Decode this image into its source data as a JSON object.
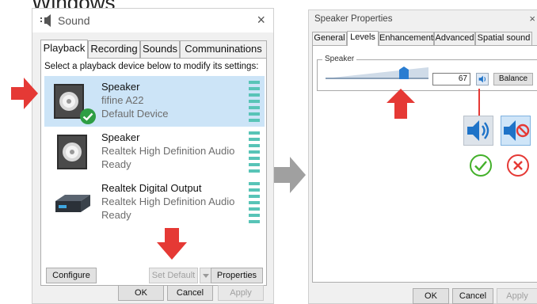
{
  "caption": "Windows",
  "sound_window": {
    "title": "Sound",
    "close_glyph": "×",
    "tabs": [
      {
        "label": "Playback",
        "active": true
      },
      {
        "label": "Recording",
        "active": false
      },
      {
        "label": "Sounds",
        "active": false
      },
      {
        "label": "Communinations",
        "active": false
      }
    ],
    "hint": "Select a playback device below to modify its settings:",
    "devices": [
      {
        "name": "Speaker",
        "sub": "fifine A22",
        "state": "Default Device",
        "selected": true,
        "icon": "speaker-box-icon",
        "badge": "green-check-icon"
      },
      {
        "name": "Speaker",
        "sub": "Realtek High Definition Audio",
        "state": "Ready",
        "selected": false,
        "icon": "speaker-box-icon"
      },
      {
        "name": "Realtek Digital Output",
        "sub": "Realtek High Definition Audio",
        "state": "Ready",
        "selected": false,
        "icon": "digital-output-box-icon"
      }
    ],
    "buttons": {
      "configure": "Configure",
      "set_default": "Set Default",
      "properties": "Properties",
      "ok": "OK",
      "cancel": "Cancel",
      "apply": "Apply"
    }
  },
  "props_window": {
    "title": "Speaker Properties",
    "close_glyph": "×",
    "tabs": [
      {
        "label": "General",
        "active": false
      },
      {
        "label": "Levels",
        "active": true
      },
      {
        "label": "Enhancements",
        "active": false
      },
      {
        "label": "Advanced",
        "active": false
      },
      {
        "label": "Spatial sound",
        "active": false
      }
    ],
    "group_label": "Speaker",
    "volume": "67",
    "balance_label": "Balance",
    "buttons": {
      "ok": "OK",
      "cancel": "Cancel",
      "apply": "Apply"
    }
  },
  "annotations": {
    "unmuted_icon": "speaker-unmuted-icon",
    "muted_icon": "speaker-muted-icon",
    "ok_mark": "green-check-circle-icon",
    "no_mark": "red-x-circle-icon"
  },
  "colors": {
    "selection": "#cce4f7",
    "meter": "#58c4b7",
    "arrow_red": "#e53935",
    "arrow_gray": "#a0a0a0",
    "speaker_blue": "#1e73c8",
    "ok_green": "#43b02a",
    "no_red": "#e53935"
  }
}
